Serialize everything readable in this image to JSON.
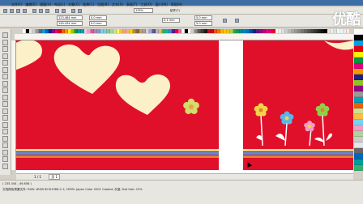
{
  "app": {
    "title": "",
    "watermark": "优酷"
  },
  "menu": {
    "items": [
      "文件(F)",
      "编辑(E)",
      "视图(V)",
      "布局(L)",
      "对象(C)",
      "效果(C)",
      "位图(B)",
      "文本(X)",
      "表格(T)",
      "工具(O)",
      "窗口(W)",
      "帮助(H)"
    ]
  },
  "toolbar": {
    "zoom_value": "135%",
    "x_value": "123.464 mm",
    "y_value": "149.434 mm",
    "w_value": "0.0 mm",
    "h_value": "0.0 mm",
    "nudge_value": "0.1 mm",
    "dup_x": "5.0 mm",
    "dup_y": "5.0 mm",
    "snap_label": "贴齐(T)"
  },
  "palette": {
    "colors": [
      "#ffffff",
      "#000000",
      "#e6e6e6",
      "#cccccc",
      "#999999",
      "#666666",
      "#00a0e9",
      "#0068b7",
      "#1d2088",
      "#920783",
      "#e4007f",
      "#e60012",
      "#eb6100",
      "#f39800",
      "#fff100",
      "#8fc31f",
      "#009944",
      "#009e96",
      "#00a0c1",
      "#f7c9dd",
      "#f19ec2",
      "#e85298",
      "#aa89bd",
      "#8c97cb",
      "#7ecef4",
      "#84ccc9",
      "#89c997",
      "#acd598",
      "#cce198",
      "#fff45c",
      "#fac03d",
      "#f29c9f",
      "#f6b37f",
      "#fdd000",
      "#b28850",
      "#7d6c46",
      "#c0a16b",
      "#a0a0a0",
      "#d3d3d3",
      "#88abda",
      "#5f52a0",
      "#b5b5b6",
      "#f8b551",
      "#32b16c",
      "#13b5b1",
      "#448aca",
      "#601986",
      "#e5004f",
      "#ea68a2",
      "#ffffff",
      "#000000",
      "#f2f2f2",
      "#c9caca",
      "#898989",
      "#595757",
      "#3e3a39",
      "#231815",
      "#c30d23",
      "#d7000f",
      "#e95513",
      "#ee7800",
      "#f8b500",
      "#fcc800",
      "#e3cb00",
      "#aacf52",
      "#22ac38",
      "#009b6b",
      "#008c8d",
      "#0086d1",
      "#0075c2",
      "#0050a2",
      "#1d2088",
      "#601986",
      "#920783",
      "#be0081",
      "#e4007f",
      "#e5006a",
      "#e60033",
      "#ffffff",
      "#eeeeee",
      "#dddddd",
      "#cccccc",
      "#bbbbbb",
      "#aaaaaa",
      "#999999",
      "#888888",
      "#777777",
      "#666666",
      "#555555",
      "#444444",
      "#333333",
      "#222222",
      "#111111",
      "#000000",
      "#ffdddd",
      "#ddffdd",
      "#ddddff",
      "#ffffdd",
      "#ddffff",
      "#ffddff",
      "#ffeecc"
    ]
  },
  "right_palette": {
    "colors": [
      "#ffffff",
      "#000000",
      "#00a0e9",
      "#e60012",
      "#fff100",
      "#009944",
      "#e4007f",
      "#f39800",
      "#1d2088",
      "#8fc31f",
      "#920783",
      "#999999",
      "#00a0c1",
      "#eb6100",
      "#cce198",
      "#fac03d",
      "#7ecef4",
      "#f19ec2",
      "#acd598",
      "#cccccc",
      "#e6e6e6",
      "#666666",
      "#0068b7",
      "#009e96",
      "#32b16c"
    ]
  },
  "pagebar": {
    "label": "1 / 1",
    "page_tab": "页 1"
  },
  "status": {
    "line1": "( 235.344 , 49.856 )",
    "line2": "文档颜色预置文件: RGB: sRGB IEC61966-2.1; CMYK: Japan Color 2001 Coated; 灰度: Dot Gain 15%"
  }
}
